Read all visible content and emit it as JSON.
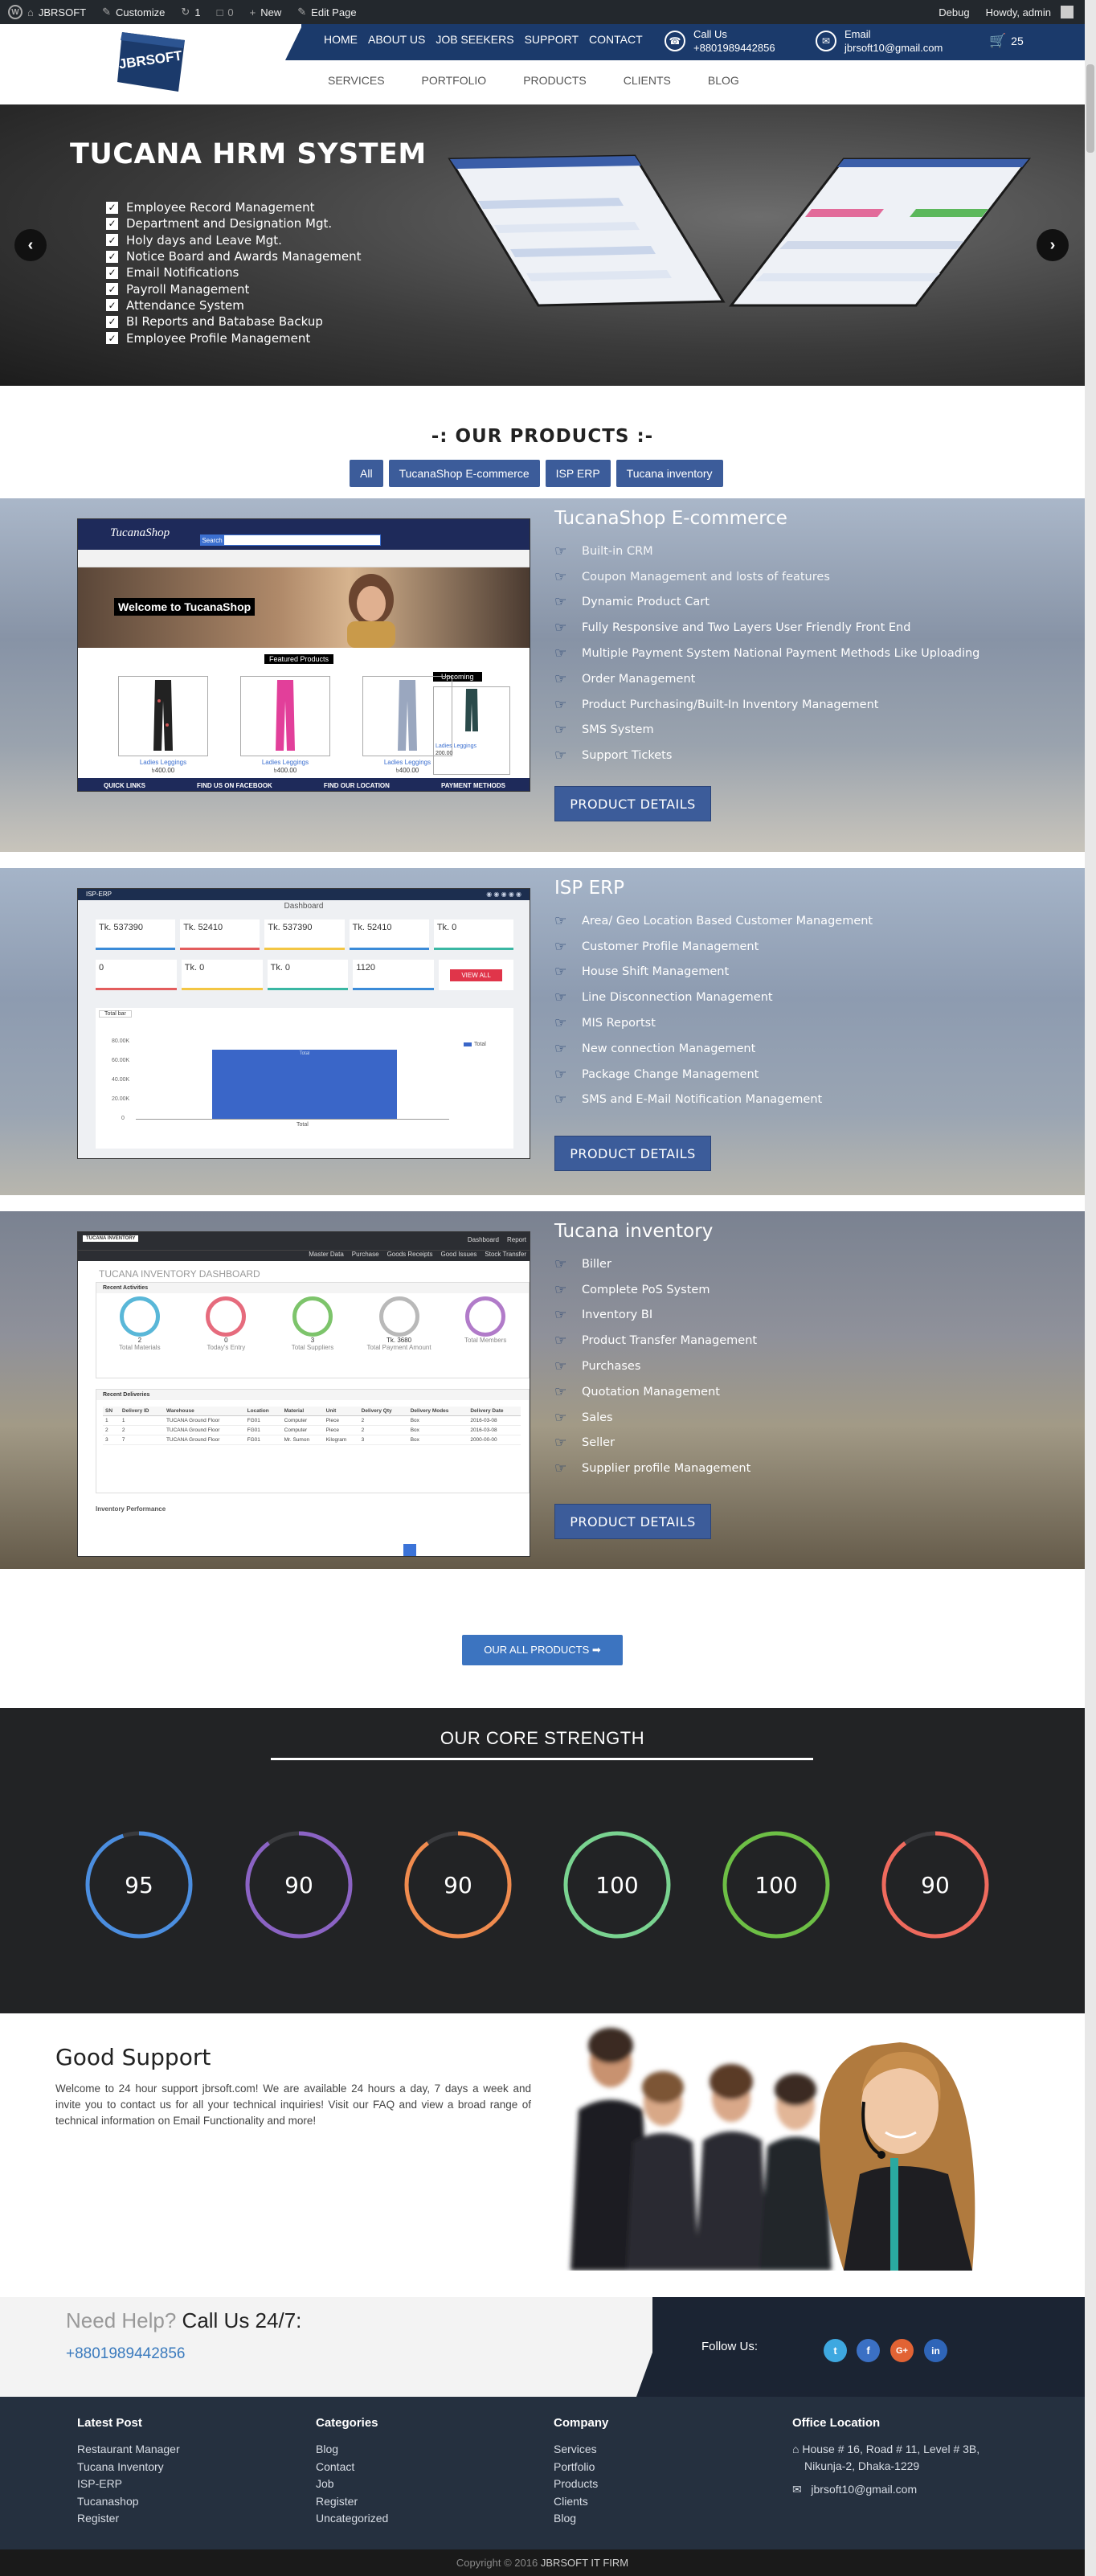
{
  "adminbar": {
    "site": "JBRSOFT",
    "customize": "Customize",
    "updates": "1",
    "comments": "0",
    "new": "New",
    "edit": "Edit Page",
    "debug": "Debug",
    "howdy": "Howdy, admin"
  },
  "header": {
    "logo_text": "JBRSOFT",
    "topnav": [
      "HOME",
      "ABOUT US",
      "JOB SEEKERS",
      "SUPPORT",
      "CONTACT"
    ],
    "call_label": "Call Us",
    "call_value": "+8801989442856",
    "email_label": "Email",
    "email_value": "jbrsoft10@gmail.com",
    "cart_count": "25",
    "subnav": [
      "SERVICES",
      "PORTFOLIO",
      "PRODUCTS",
      "CLIENTS",
      "BLOG"
    ]
  },
  "hero": {
    "title": "TUCANA HRM SYSTEM",
    "features": [
      "Employee Record Management",
      "Department and Designation Mgt.",
      "Holy days and Leave Mgt.",
      "Notice Board and Awards Management",
      "Email Notifications",
      "Payroll Management",
      "Attendance System",
      "BI Reports and Batabase Backup",
      "Employee Profile Management"
    ]
  },
  "products": {
    "heading": "-: OUR PRODUCTS :-",
    "filters": [
      "All",
      "TucanaShop E-commerce",
      "ISP ERP",
      "Tucana inventory"
    ],
    "items": [
      {
        "title": "TucanaShop E-commerce",
        "features": [
          "Built-in CRM",
          "Coupon Management and losts of features",
          "Dynamic Product Cart",
          "Fully Responsive and Two Layers User Friendly Front End",
          "Multiple Payment System National Payment Methods Like Uploading",
          "Order Management",
          "Product Purchasing/Built-In Inventory Management",
          "SMS System",
          "Support Tickets"
        ],
        "button": "PRODUCT DETAILS",
        "shot": {
          "brand": "TucanaShop",
          "search": "Search",
          "welcome": "Welcome to TucanaShop",
          "featured": "Featured Products",
          "upcoming": "Upcoming",
          "product_names": [
            "Ladies Leggings",
            "Ladies Leggings",
            "Ladies Leggings",
            "Ladies Leggings"
          ],
          "product_prices": [
            "৳400.00",
            "৳400.00",
            "৳400.00",
            "200.00"
          ],
          "footer_links": [
            "QUICK LINKS",
            "FIND US ON FACEBOOK",
            "FIND OUR LOCATION",
            "PAYMENT METHODS"
          ]
        }
      },
      {
        "title": "ISP ERP",
        "features": [
          "Area/ Geo Location Based Customer Management",
          "Customer Profile Management",
          "House Shift Management",
          "Line Disconnection Management",
          "MIS Reportst",
          "New connection Management",
          "Package Change Management",
          "SMS and E-Mail Notification Management"
        ],
        "button": "PRODUCT DETAILS",
        "shot": {
          "brand": "ISP-ERP",
          "header": "Dashboard",
          "cards_row1": [
            "Tk. 537390",
            "Tk. 52410",
            "Tk. 537390",
            "Tk. 52410",
            "Tk. 0"
          ],
          "cards_row2": [
            "0",
            "Tk. 0",
            "Tk. 0",
            "1120"
          ],
          "view_all": "VIEW ALL",
          "chart_button": "Total bar",
          "y_ticks": [
            "80.00K",
            "60.00K",
            "40.00K",
            "20.00K",
            "0"
          ],
          "bar_label": "Total",
          "x_label": "Total",
          "legend": "Total"
        }
      },
      {
        "title": "Tucana inventory",
        "features": [
          "Biller",
          "Complete PoS System",
          "Inventory BI",
          "Product Transfer Management",
          "Purchases",
          "Quotation Management",
          "Sales",
          "Seller",
          "Supplier profile Management"
        ],
        "button": "PRODUCT DETAILS",
        "shot": {
          "brand": "TUCANA INVENTORY",
          "nav": [
            "Dashboard",
            "Report"
          ],
          "menu": [
            "Master Data",
            "Purchase",
            "Goods Receipts",
            "Good Issues",
            "Stock Transfer"
          ],
          "title": "TUCANA INVENTORY DASHBOARD",
          "recent_activities": "Recent Activities",
          "activity_values": [
            "2",
            "0",
            "3",
            "Tk. 3680",
            ""
          ],
          "activity_labels": [
            "Total Materials",
            "Today's Entry",
            "Total Suppliers",
            "Total Payment Amount",
            "Total Members"
          ],
          "recent_deliveries": "Recent Deliveries",
          "columns": [
            "SN",
            "Delivery ID",
            "Warehouse",
            "Location",
            "Material",
            "Unit",
            "Delivery Qty",
            "Delivery Modes",
            "Delivery Date"
          ],
          "rows": [
            [
              "1",
              "1",
              "TUCANA Ground Floor",
              "FG01",
              "Computer",
              "Piece",
              "2",
              "Box",
              "2016-03-08"
            ],
            [
              "2",
              "2",
              "TUCANA Ground Floor",
              "FG01",
              "Computer",
              "Piece",
              "2",
              "Box",
              "2016-03-08"
            ],
            [
              "3",
              "7",
              "TUCANA Ground Floor",
              "FG01",
              "Mr. Sumon",
              "Kilogram",
              "3",
              "Box",
              "2000-00-00"
            ]
          ],
          "performance": "Inventory Performance"
        }
      }
    ],
    "all_button": "OUR ALL PRODUCTS ➡"
  },
  "core": {
    "title": "OUR CORE STRENGTH",
    "gauges": [
      {
        "value": "95",
        "percent": 95,
        "color": "#4b8ee0"
      },
      {
        "value": "90",
        "percent": 90,
        "color": "#8b63c4"
      },
      {
        "value": "90",
        "percent": 90,
        "color": "#f08b4e"
      },
      {
        "value": "100",
        "percent": 100,
        "color": "#79d390"
      },
      {
        "value": "100",
        "percent": 100,
        "color": "#6dbf45"
      },
      {
        "value": "90",
        "percent": 90,
        "color": "#ef6a5d"
      }
    ]
  },
  "support": {
    "title": "Good Support",
    "text": "Welcome to 24 hour support jbrsoft.com! We are available 24 hours a day, 7 days a week and invite you to contact us for all your technical inquiries! Visit our FAQ and view a broad range of technical information on Email Functionality and more!"
  },
  "help": {
    "title_light": "Need Help?",
    "title_dark": "Call Us 24/7:",
    "phone": "+8801989442856",
    "follow": "Follow Us:",
    "social": [
      "twitter",
      "facebook",
      "google-plus",
      "linkedin"
    ]
  },
  "footer": {
    "latest_title": "Latest Post",
    "latest": [
      "Restaurant Manager",
      "Tucana Inventory",
      "ISP-ERP",
      "Tucanashop",
      "Register"
    ],
    "categories_title": "Categories",
    "categories": [
      "Blog",
      "Contact",
      "Job",
      "Register",
      "Uncategorized"
    ],
    "company_title": "Company",
    "company": [
      "Services",
      "Portfolio",
      "Products",
      "Clients",
      "Blog"
    ],
    "office_title": "Office Location",
    "address_1": "House # 16, Road # 11, Level # 3B,",
    "address_2": "Nikunja-2, Dhaka-1229",
    "email": "jbrsoft10@gmail.com",
    "copyright_pre": "Copyright © 2016",
    "copyright_firm": "JBRSOFT IT FIRM"
  },
  "colors": {
    "brand_navy": "#1b3a6b",
    "button_blue": "#3c5c9a",
    "link_blue": "#3a7abd",
    "dark_bg": "#222325",
    "footer_bg": "#25303f"
  }
}
